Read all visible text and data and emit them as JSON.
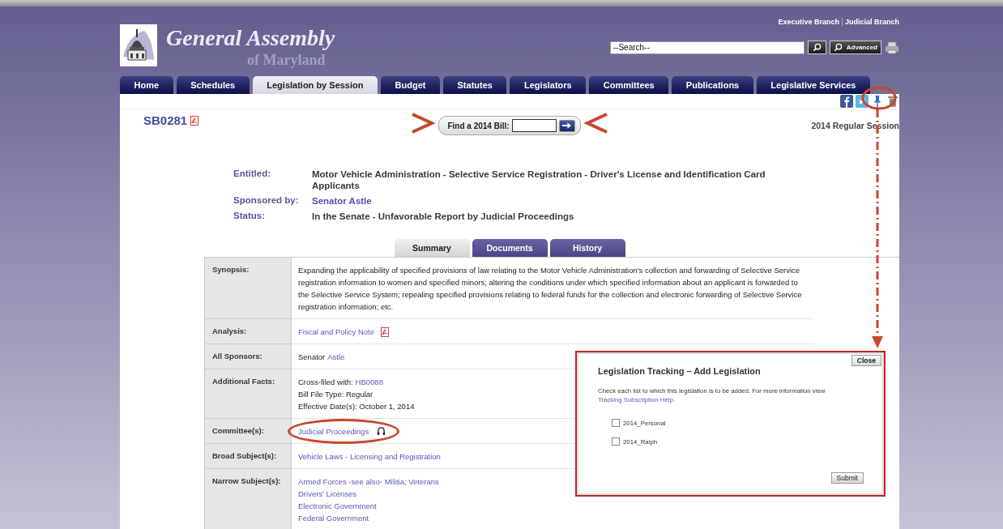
{
  "header": {
    "title": "General Assembly",
    "subtitle": "of Maryland",
    "top_links": [
      "Executive Branch",
      "Judicial Branch"
    ],
    "search": {
      "placeholder": "--Search--"
    },
    "advanced_button": "Advanced"
  },
  "nav_tabs": [
    {
      "label": "Home",
      "selected": false
    },
    {
      "label": "Schedules",
      "selected": false
    },
    {
      "label": "Legislation by Session",
      "selected": true
    },
    {
      "label": "Budget",
      "selected": false
    },
    {
      "label": "Statutes",
      "selected": false
    },
    {
      "label": "Legislators",
      "selected": false
    },
    {
      "label": "Committees",
      "selected": false
    },
    {
      "label": "Publications",
      "selected": false
    },
    {
      "label": "Legislative Services",
      "selected": false
    }
  ],
  "bill": {
    "number": "SB0281",
    "find_label": "Find a 2014 Bill:",
    "session": "2014 Regular Session"
  },
  "details": [
    {
      "label": "Entitled:",
      "value": "Motor Vehicle Administration - Selective Service Registration - Driver's License and Identification Card Applicants",
      "kind": "text"
    },
    {
      "label": "Sponsored by:",
      "value": "Senator Astle",
      "kind": "link"
    },
    {
      "label": "Status:",
      "value": "In the Senate - Unfavorable Report by Judicial Proceedings",
      "kind": "text"
    }
  ],
  "detail_tabs": [
    {
      "label": "Summary",
      "selected": true
    },
    {
      "label": "Documents",
      "selected": false
    },
    {
      "label": "History",
      "selected": false
    }
  ],
  "table": {
    "rows": [
      {
        "label": "Synopsis:",
        "lines": [
          [
            {
              "text": "Expanding the applicability of specified provisions of law relating to the Motor Vehicle Administration's collection and forwarding of Selective Service registration information to women and specified minors; altering the conditions under which specified information about an applicant is forwarded to the Selective Service System; repealing specified provisions relating to federal funds for the collection and electronic forwarding of Selective Service registration information; etc.",
              "kind": "text"
            }
          ]
        ]
      },
      {
        "label": "Analysis:",
        "lines": [
          [
            {
              "text": "Fiscal and Policy Note",
              "kind": "pdf-link"
            }
          ]
        ]
      },
      {
        "label": "All Sponsors:",
        "lines": [
          [
            {
              "text": "Senator",
              "kind": "text"
            },
            {
              "text": "Astle",
              "kind": "link"
            }
          ]
        ]
      },
      {
        "label": "Additional Facts:",
        "lines": [
          [
            {
              "text": "Cross-filed with:",
              "kind": "text"
            },
            {
              "text": "HB0088",
              "kind": "link"
            }
          ],
          [
            {
              "text": "Bill File Type: Regular",
              "kind": "text"
            }
          ],
          [
            {
              "text": "Effective Date(s): October 1, 2014",
              "kind": "text"
            }
          ]
        ]
      },
      {
        "label": "Committee(s):",
        "lines": [
          [
            {
              "text": "Judicial Proceedings",
              "kind": "audio-link"
            }
          ]
        ]
      },
      {
        "label": "Broad Subject(s):",
        "lines": [
          [
            {
              "text": "Vehicle Laws - Licensing and Registration",
              "kind": "link"
            }
          ]
        ]
      },
      {
        "label": "Narrow Subject(s):",
        "lines": [
          [
            {
              "text": "Armed Forces -see also- Militia; Veterans",
              "kind": "link"
            }
          ],
          [
            {
              "text": "Drivers' Licenses",
              "kind": "link"
            }
          ],
          [
            {
              "text": "Electronic Government",
              "kind": "link"
            }
          ],
          [
            {
              "text": "Federal Government",
              "kind": "link"
            }
          ]
        ]
      }
    ]
  },
  "popup": {
    "close_button": "Close",
    "title": "Legislation Tracking – Add Legislation",
    "instructions": "Check each list to which this legislation is to be added. For more information view",
    "help_link": "Tracking Subscription Help.",
    "lists": [
      {
        "label": "2014_Personal",
        "checked": false
      },
      {
        "label": "2014_Ralph",
        "checked": false
      }
    ],
    "submit_button": "Submit"
  }
}
